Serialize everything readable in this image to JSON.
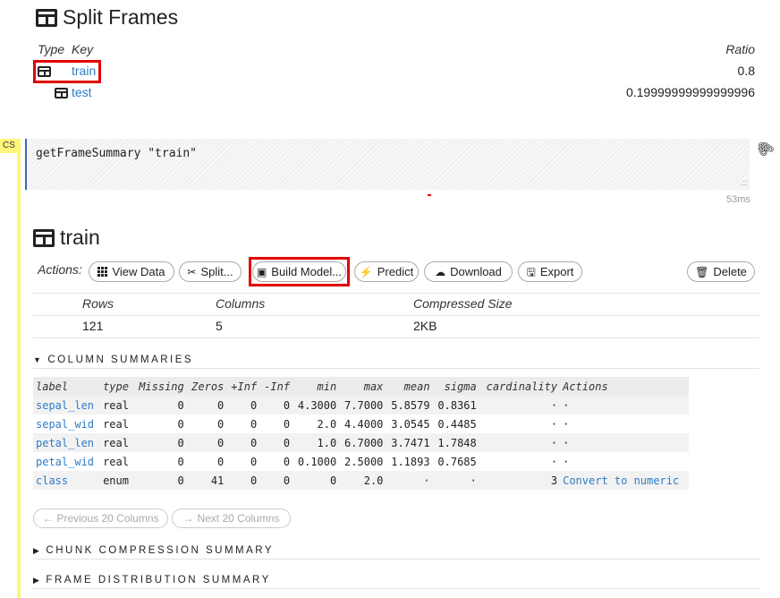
{
  "split_frames": {
    "title": "Split Frames",
    "headers": {
      "type": "Type",
      "key": "Key",
      "ratio": "Ratio"
    },
    "rows": [
      {
        "key": "train",
        "ratio": "0.8"
      },
      {
        "key": "test",
        "ratio": "0.19999999999999996"
      }
    ]
  },
  "cell": {
    "label": "CS",
    "code": "getFrameSummary \"train\"",
    "timing": "53ms"
  },
  "frame": {
    "title": "train",
    "actions_label": "Actions:",
    "buttons": {
      "view_data": "View Data",
      "split": "Split...",
      "build_model": "Build Model...",
      "predict": "Predict",
      "download": "Download",
      "export": "Export",
      "delete": "Delete"
    },
    "stats": {
      "headers": {
        "rows": "Rows",
        "columns": "Columns",
        "size": "Compressed Size"
      },
      "values": {
        "rows": "121",
        "columns": "5",
        "size": "2KB"
      }
    }
  },
  "sections": {
    "column_summaries": "COLUMN SUMMARIES",
    "chunk_compression": "CHUNK COMPRESSION SUMMARY",
    "frame_distribution": "FRAME DISTRIBUTION SUMMARY"
  },
  "column_table": {
    "headers": [
      "label",
      "type",
      "Missing",
      "Zeros",
      "+Inf",
      "-Inf",
      "min",
      "max",
      "mean",
      "sigma",
      "cardinality",
      "Actions"
    ],
    "rows": [
      {
        "label": "sepal_len",
        "type": "real",
        "missing": "0",
        "zeros": "0",
        "pinf": "0",
        "ninf": "0",
        "min": "4.3000",
        "max": "7.7000",
        "mean": "5.8579",
        "sigma": "0.8361",
        "cardinality": "·",
        "action": "·"
      },
      {
        "label": "sepal_wid",
        "type": "real",
        "missing": "0",
        "zeros": "0",
        "pinf": "0",
        "ninf": "0",
        "min": "2.0",
        "max": "4.4000",
        "mean": "3.0545",
        "sigma": "0.4485",
        "cardinality": "·",
        "action": "·"
      },
      {
        "label": "petal_len",
        "type": "real",
        "missing": "0",
        "zeros": "0",
        "pinf": "0",
        "ninf": "0",
        "min": "1.0",
        "max": "6.7000",
        "mean": "3.7471",
        "sigma": "1.7848",
        "cardinality": "·",
        "action": "·"
      },
      {
        "label": "petal_wid",
        "type": "real",
        "missing": "0",
        "zeros": "0",
        "pinf": "0",
        "ninf": "0",
        "min": "0.1000",
        "max": "2.5000",
        "mean": "1.1893",
        "sigma": "0.7685",
        "cardinality": "·",
        "action": "·"
      },
      {
        "label": "class",
        "type": "enum",
        "missing": "0",
        "zeros": "41",
        "pinf": "0",
        "ninf": "0",
        "min": "0",
        "max": "2.0",
        "mean": "·",
        "sigma": "·",
        "cardinality": "3",
        "action": "Convert to numeric"
      }
    ]
  },
  "pager": {
    "previous": "Previous 20 Columns",
    "next": "Next 20 Columns"
  },
  "highlight_color": "#e30000",
  "link_color": "#2f7cc4",
  "gutter_color": "#fff67a"
}
